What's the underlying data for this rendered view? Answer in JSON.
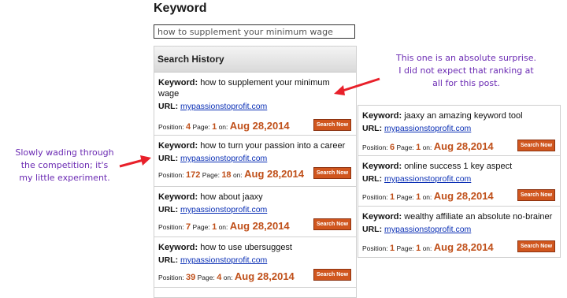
{
  "page": {
    "title": "Keyword"
  },
  "search": {
    "value": "how to supplement your minimum wage"
  },
  "history": {
    "title": "Search History",
    "labels": {
      "keyword": "Keyword:",
      "url": "URL:",
      "position": "Position:",
      "page": "Page:",
      "on": "on:",
      "button": "Search Now"
    },
    "items": [
      {
        "keyword": "how to supplement your minimum wage",
        "url": "mypassionstoprofit.com",
        "position": "4",
        "page": "1",
        "date": "Aug 28,2014"
      },
      {
        "keyword": "how to turn your passion into a career",
        "url": "mypassionstoprofit.com",
        "position": "172",
        "page": "18",
        "date": "Aug 28,2014"
      },
      {
        "keyword": "how about jaaxy",
        "url": "mypassionstoprofit.com",
        "position": "7",
        "page": "1",
        "date": "Aug 28,2014"
      },
      {
        "keyword": "how to use ubersuggest",
        "url": "mypassionstoprofit.com",
        "position": "39",
        "page": "4",
        "date": "Aug 28,2014"
      }
    ],
    "right_items": [
      {
        "keyword": "jaaxy an amazing keyword tool",
        "url": "mypassionstoprofit.com",
        "position": "6",
        "page": "1",
        "date": "Aug 28,2014"
      },
      {
        "keyword": "online success 1 key aspect",
        "url": "mypassionstoprofit.com",
        "position": "1",
        "page": "1",
        "date": "Aug 28,2014"
      },
      {
        "keyword": "wealthy affiliate an absolute no-brainer",
        "url": "mypassionstoprofit.com",
        "position": "1",
        "page": "1",
        "date": "Aug 28,2014"
      }
    ]
  },
  "annotations": {
    "right_note": [
      "This one is an absolute surprise.",
      "I did not expect that ranking at",
      "all for this post."
    ],
    "left_note": [
      "Slowly wading through",
      "the competition; it's",
      "my little experiment."
    ]
  },
  "colors": {
    "accent": "#c0501a",
    "button": "#d0561e",
    "link": "#0a2fb5",
    "annotation": "#6b2bb3",
    "arrow": "#e8202a"
  }
}
